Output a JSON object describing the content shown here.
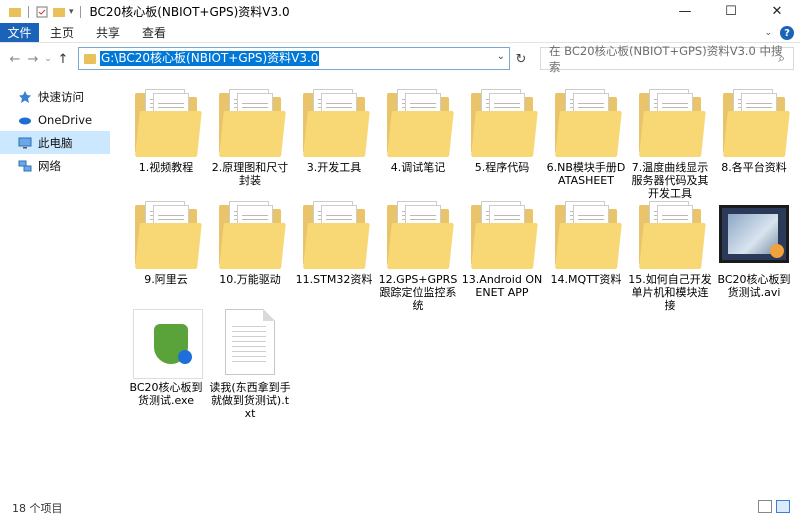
{
  "window": {
    "title": "BC20核心板(NBIOT+GPS)资料V3.0",
    "controls": [
      "minimize",
      "maximize",
      "close"
    ]
  },
  "ribbon": {
    "tabs": [
      "文件",
      "主页",
      "共享",
      "查看"
    ]
  },
  "address": {
    "path": "G:\\BC20核心板(NBIOT+GPS)资料V3.0",
    "search_placeholder": "在 BC20核心板(NBIOT+GPS)资料V3.0 中搜索"
  },
  "sidebar": {
    "items": [
      {
        "label": "快速访问",
        "icon": "star-icon"
      },
      {
        "label": "OneDrive",
        "icon": "cloud-icon"
      },
      {
        "label": "此电脑",
        "icon": "computer-icon"
      },
      {
        "label": "网络",
        "icon": "network-icon"
      }
    ],
    "selected": "此电脑"
  },
  "files": [
    {
      "name": "1.视频教程",
      "type": "folder"
    },
    {
      "name": "2.原理图和尺寸封装",
      "type": "folder"
    },
    {
      "name": "3.开发工具",
      "type": "folder"
    },
    {
      "name": "4.调试笔记",
      "type": "folder"
    },
    {
      "name": "5.程序代码",
      "type": "folder"
    },
    {
      "name": "6.NB模块手册DATASHEET",
      "type": "folder"
    },
    {
      "name": "7.温度曲线显示服务器代码及其开发工具",
      "type": "folder"
    },
    {
      "name": "8.各平台资料",
      "type": "folder"
    },
    {
      "name": "9.阿里云",
      "type": "folder"
    },
    {
      "name": "10.万能驱动",
      "type": "folder"
    },
    {
      "name": "11.STM32资料",
      "type": "folder"
    },
    {
      "name": "12.GPS+GPRS跟踪定位监控系统",
      "type": "folder"
    },
    {
      "name": "13.Android ONENET APP",
      "type": "folder"
    },
    {
      "name": "14.MQTT资料",
      "type": "folder"
    },
    {
      "name": "15.如何自己开发单片机和模块连接",
      "type": "folder"
    },
    {
      "name": "BC20核心板到货测试.avi",
      "type": "video"
    },
    {
      "name": "BC20核心板到货测试.exe",
      "type": "exe"
    },
    {
      "name": "读我(东西拿到手就做到货测试).txt",
      "type": "txt"
    }
  ],
  "status": {
    "item_count": "18 个项目"
  },
  "colors": {
    "accent": "#1a63b8",
    "selection": "#0078d7",
    "folder": "#f8d775"
  }
}
